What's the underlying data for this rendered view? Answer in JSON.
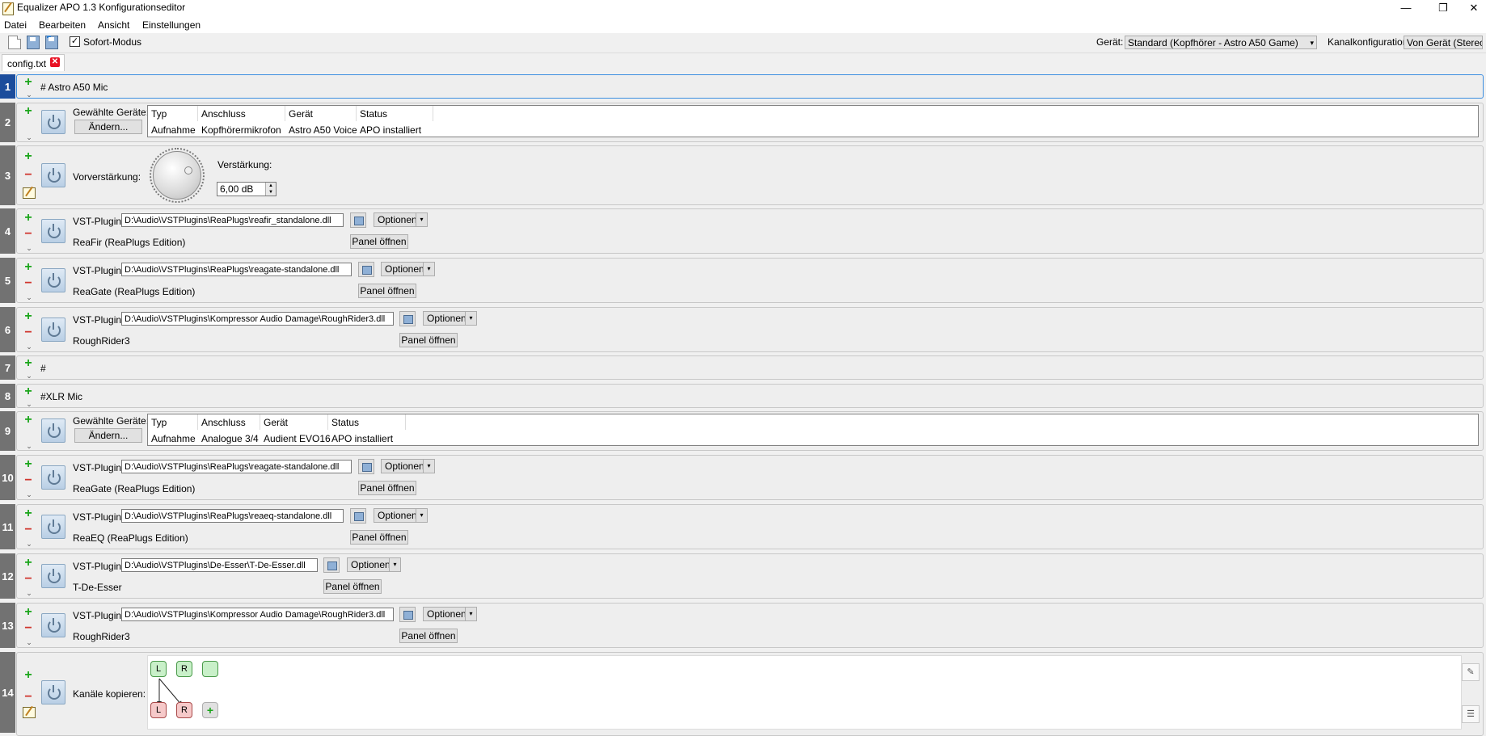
{
  "window": {
    "title": "Equalizer APO 1.3 Konfigurationseditor",
    "minimize": "—",
    "restore": "❐",
    "close": "✕"
  },
  "menu": [
    "Datei",
    "Bearbeiten",
    "Ansicht",
    "Einstellungen"
  ],
  "toolbar": {
    "instant_mode": "Sofort-Modus",
    "instant_mode_checked": "✓",
    "device_label": "Gerät:",
    "device_value": "Standard (Kopfhörer - Astro A50 Game)",
    "channel_label": "Kanalkonfiguration:",
    "channel_value": "Von Gerät (Stereo)"
  },
  "tab": {
    "label": "config.txt",
    "close": "✕"
  },
  "controls": {
    "plus": "+",
    "minus": "−",
    "expand": "⌄",
    "dropdown": "▾",
    "spin_up": "▲",
    "spin_down": "▼"
  },
  "rows": [
    {
      "num": "1",
      "text": "# Astro A50 Mic"
    },
    {
      "num": "2",
      "label": "Gewählte Geräte:",
      "change": "Ändern...",
      "headers": [
        "Typ",
        "Anschluss",
        "Gerät",
        "Status"
      ],
      "values": [
        "Aufnahme",
        "Kopfhörermikrofon",
        "Astro A50 Voice",
        "APO installiert"
      ]
    },
    {
      "num": "3",
      "label": "Vorverstärkung:",
      "gain_label": "Verstärkung:",
      "gain_value": "6,00 dB"
    },
    {
      "num": "4",
      "label": "VST-Plugin:",
      "path": "D:\\Audio\\VSTPlugins\\ReaPlugs\\reafir_standalone.dll",
      "name": "ReaFir (ReaPlugs Edition)",
      "options": "Optionen",
      "panel": "Panel öffnen"
    },
    {
      "num": "5",
      "label": "VST-Plugin:",
      "path": "D:\\Audio\\VSTPlugins\\ReaPlugs\\reagate-standalone.dll",
      "name": "ReaGate (ReaPlugs Edition)",
      "options": "Optionen",
      "panel": "Panel öffnen"
    },
    {
      "num": "6",
      "label": "VST-Plugin:",
      "path": "D:\\Audio\\VSTPlugins\\Kompressor Audio Damage\\RoughRider3.dll",
      "name": "RoughRider3",
      "options": "Optionen",
      "panel": "Panel öffnen"
    },
    {
      "num": "7",
      "text": "#"
    },
    {
      "num": "8",
      "text": "#XLR Mic"
    },
    {
      "num": "9",
      "label": "Gewählte Geräte:",
      "change": "Ändern...",
      "headers": [
        "Typ",
        "Anschluss",
        "Gerät",
        "Status"
      ],
      "values": [
        "Aufnahme",
        "Analogue 3/4",
        "Audient EVO16",
        "APO installiert"
      ]
    },
    {
      "num": "10",
      "label": "VST-Plugin:",
      "path": "D:\\Audio\\VSTPlugins\\ReaPlugs\\reagate-standalone.dll",
      "name": "ReaGate (ReaPlugs Edition)",
      "options": "Optionen",
      "panel": "Panel öffnen"
    },
    {
      "num": "11",
      "label": "VST-Plugin:",
      "path": "D:\\Audio\\VSTPlugins\\ReaPlugs\\reaeq-standalone.dll",
      "name": "ReaEQ (ReaPlugs Edition)",
      "options": "Optionen",
      "panel": "Panel öffnen"
    },
    {
      "num": "12",
      "label": "VST-Plugin:",
      "path": "D:\\Audio\\VSTPlugins\\De-Esser\\T-De-Esser.dll",
      "name": "T-De-Esser",
      "options": "Optionen",
      "panel": "Panel öffnen"
    },
    {
      "num": "13",
      "label": "VST-Plugin:",
      "path": "D:\\Audio\\VSTPlugins\\Kompressor Audio Damage\\RoughRider3.dll",
      "name": "RoughRider3",
      "options": "Optionen",
      "panel": "Panel öffnen"
    },
    {
      "num": "14",
      "label": "Kanäle kopieren:",
      "source_channels": [
        "L",
        "R",
        ""
      ],
      "target_channels": [
        "L",
        "R"
      ],
      "add_channel": "+"
    }
  ]
}
